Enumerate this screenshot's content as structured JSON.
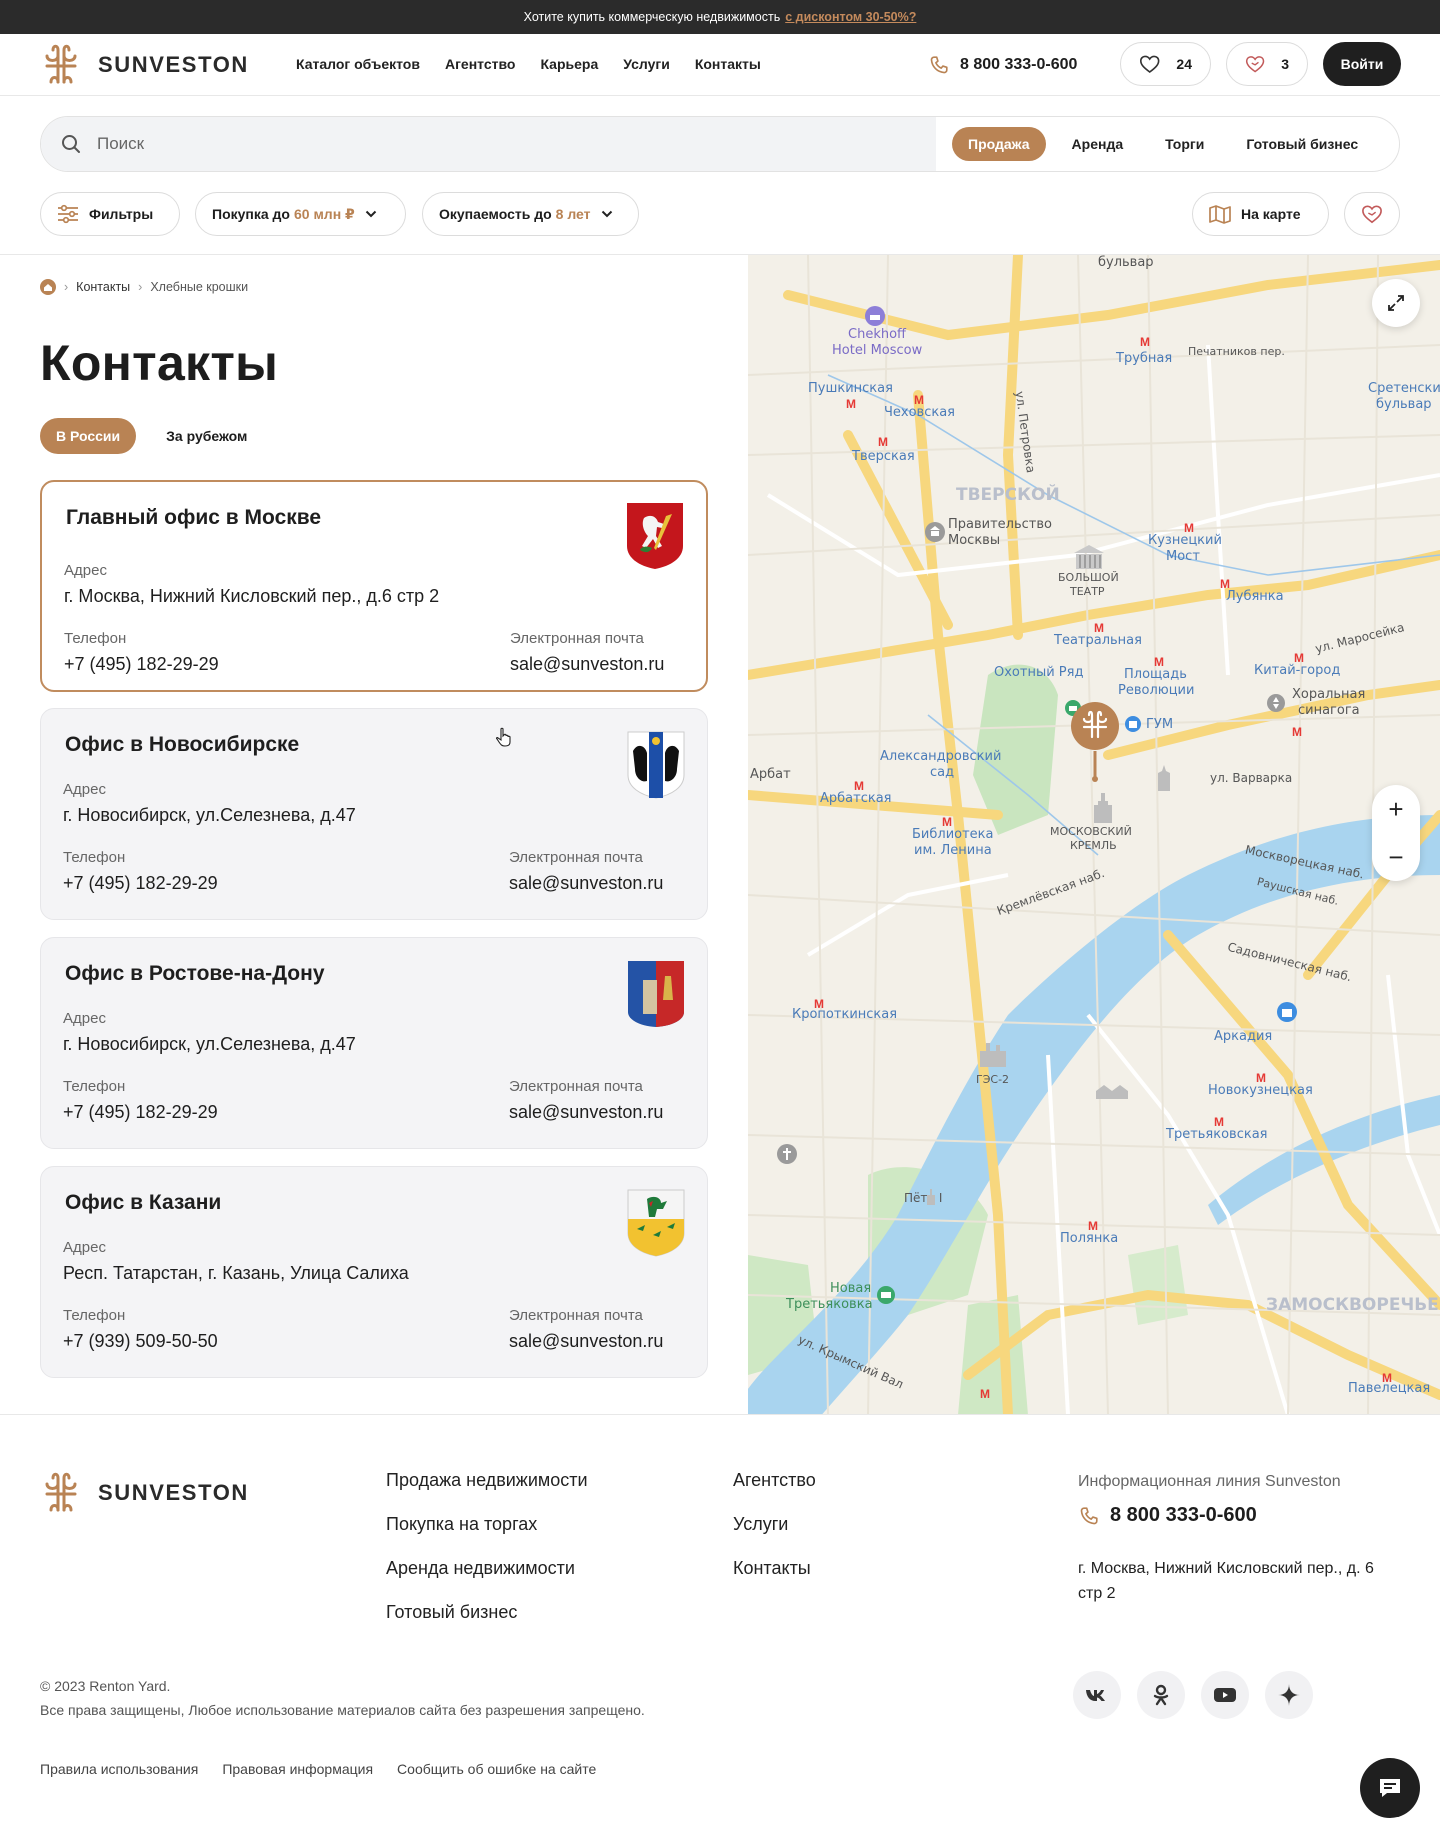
{
  "promo": {
    "text": "Хотите купить коммерческую недвижимость",
    "link": "с дисконтом 30-50%?"
  },
  "brand": {
    "name": "SUNVESTON",
    "accent": "#b98354",
    "dark": "#1f1f1f"
  },
  "nav": [
    "Каталог объектов",
    "Агентство",
    "Карьера",
    "Услуги",
    "Контакты"
  ],
  "header": {
    "phone": "8 800 333-0-600",
    "favorites_count": "24",
    "compare_count": "3",
    "login": "Войти"
  },
  "search": {
    "placeholder": "Поиск",
    "tabs": [
      "Продажа",
      "Аренда",
      "Торги",
      "Готовый бизнес"
    ],
    "active_tab": "Продажа"
  },
  "filters": {
    "filters_label": "Фильтры",
    "purchase_label": "Покупка до",
    "purchase_value": "60 млн ₽",
    "payback_label": "Окупаемость до",
    "payback_value": "8 лет",
    "map_label": "На карте"
  },
  "breadcrumbs": [
    "Контакты",
    "Хлебные крошки"
  ],
  "page_title": "Контакты",
  "region_tabs": [
    "В России",
    "За рубежом"
  ],
  "field_labels": {
    "address": "Адрес",
    "phone": "Телефон",
    "email": "Электронная почта"
  },
  "offices": [
    {
      "title": "Главный офис в Москве",
      "address": "г. Москва, Нижний Кисловский пер., д.6 стр 2",
      "phone": "+7 (495) 182-29-29",
      "email": "sale@sunveston.ru",
      "crest": "moscow-crest-icon"
    },
    {
      "title": "Офис в Новосибирске",
      "address": "г. Новосибирск, ул.Селезнева, д.47",
      "phone": "+7 (495) 182-29-29",
      "email": "sale@sunveston.ru",
      "crest": "novosibirsk-crest-icon"
    },
    {
      "title": "Офис в Ростове-на-Дону",
      "address": "г. Новосибирск, ул.Селезнева, д.47",
      "phone": "+7 (495) 182-29-29",
      "email": "sale@sunveston.ru",
      "crest": "rostov-crest-icon"
    },
    {
      "title": "Офис в Казани",
      "address": "Респ. Татарстан, г. Казань, Улица Салиха",
      "phone": "+7 (939) 509-50-50",
      "email": "sale@sunveston.ru",
      "crest": "kazan-crest-icon"
    }
  ],
  "map": {
    "labels": [
      "бульвар",
      "Chekhoff",
      "Hotel Moscow",
      "Трубная",
      "Печатников пер.",
      "Пушкинская",
      "Чеховская",
      "Тверская",
      "ТВЕРСКОЙ",
      "Правительство",
      "Москвы",
      "Кузнецкий",
      "Мост",
      "БОЛЬШОЙ",
      "ТЕАТР",
      "Лубянка",
      "Театральная",
      "Охотный Ряд",
      "Площадь",
      "Революции",
      "Китай-город",
      "Хоральная",
      "синагога",
      "ГУМ",
      "Александровский",
      "сад",
      "Арбат",
      "Арбатская",
      "Библиотека",
      "им. Ленина",
      "МОСКОВСКИЙ",
      "КРЕМЛЬ",
      "ул. Варварка",
      "Москворецкая наб.",
      "Раушская наб.",
      "Кремлёвская наб.",
      "Садовническая наб.",
      "Кропоткинская",
      "Аркадия",
      "ГЭС-2",
      "Новокузнецкая",
      "Третьяковская",
      "Пётр I",
      "Полянка",
      "Новая",
      "Третьяковка",
      "ЗАМОСКВОРЕЧЬЕ",
      "Павелецкая",
      "ул. Маросейка",
      "Сретенский",
      "бульвар",
      "ул. Петровка",
      "ул. Крымский Вал"
    ],
    "zoom_in": "+",
    "zoom_out": "−"
  },
  "footer": {
    "col1": [
      "Продажа недвижимости",
      "Покупка на торгах",
      "Аренда недвижимости",
      "Готовый бизнес"
    ],
    "col2": [
      "Агентство",
      "Услуги",
      "Контакты"
    ],
    "info_label": "Информационная линия Sunveston",
    "phone": "8 800 333-0-600",
    "address": "г. Москва, Нижний Кисловский пер., д. 6 стр 2",
    "copyright": "© 2023 Renton Yard.",
    "rights": "Все права защищены, Любое использование материалов сайта без разрешения запрещено.",
    "legal": [
      "Правила использования",
      "Правовая информация",
      "Сообщить об ошибке на сайте"
    ],
    "socials": [
      "vk-icon",
      "odnoklassniki-icon",
      "youtube-icon",
      "dzen-icon"
    ]
  }
}
